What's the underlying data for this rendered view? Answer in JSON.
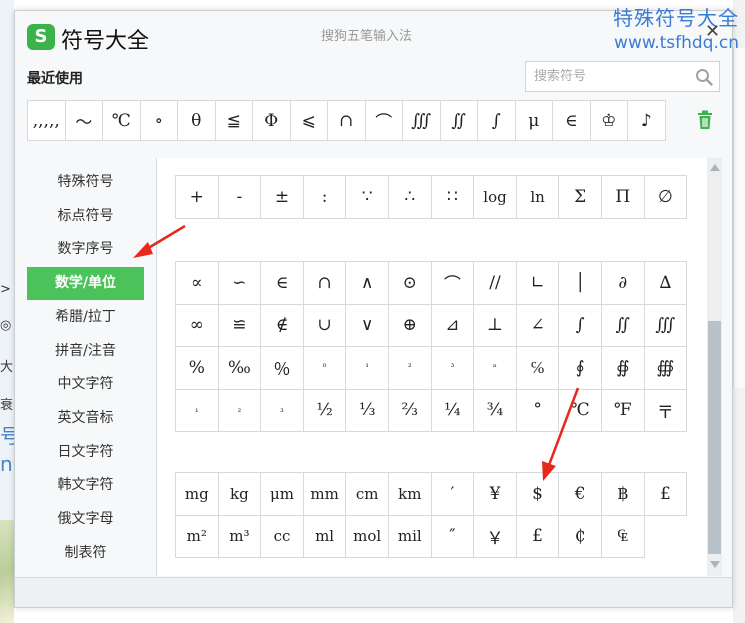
{
  "watermark": {
    "line1": "特殊符号大全",
    "line2": "www.tsfhdq.cn"
  },
  "window": {
    "logo_letter": "S",
    "app_title": "符号大全",
    "ime_name": "搜狗五笔输入法",
    "close_glyph": "✕"
  },
  "recent": {
    "label": "最近使用",
    "symbols": [
      ",,,,,",
      "～",
      "℃",
      "∘",
      "θ",
      "≦",
      "Φ",
      "⩽",
      "∩",
      "⌒",
      "∭",
      "∬",
      "∫",
      "μ",
      "∈",
      "♔",
      "♪"
    ]
  },
  "search": {
    "placeholder": "搜索符号"
  },
  "nav": {
    "items": [
      "特殊符号",
      "标点符号",
      "数字序号",
      "数学/单位",
      "希腊/拉丁",
      "拼音/注音",
      "中文字符",
      "英文音标",
      "日文字符",
      "韩文字符",
      "俄文字母",
      "制表符"
    ],
    "active_index": 3
  },
  "grid_top": [
    [
      "+",
      "-",
      "±",
      ":",
      "∵",
      "∴",
      "∷",
      "log",
      "ln",
      "Σ",
      "Π",
      "∅"
    ]
  ],
  "grid_math": [
    [
      "∝",
      "∽",
      "∈",
      "∩",
      "∧",
      "⊙",
      "⌒",
      "//",
      "∟",
      "│",
      "∂",
      "∆"
    ],
    [
      "∞",
      "≌",
      "∉",
      "∪",
      "∨",
      "⊕",
      "⊿",
      "⊥",
      "∠",
      "∫",
      "∬",
      "∭"
    ],
    [
      "%",
      "‰",
      "％",
      "⁰",
      "¹",
      "²",
      "³",
      "ⁿ",
      "℅",
      "∮",
      "∯",
      "∰"
    ],
    [
      "₁",
      "₂",
      "₃",
      "½",
      "⅓",
      "⅔",
      "¼",
      "¾",
      "°",
      "℃",
      "℉",
      "〒"
    ]
  ],
  "grid_units": [
    [
      "mg",
      "kg",
      "μm",
      "mm",
      "cm",
      "km",
      "′",
      "¥",
      "$",
      "€",
      "฿",
      "£"
    ],
    [
      "m²",
      "m³",
      "cc",
      "ml",
      "mol",
      "mil",
      "″",
      "￥",
      "£",
      "₵",
      "₠"
    ]
  ],
  "colors": {
    "accent": "#4cc35a",
    "annotation": "#e8281d",
    "watermark": "#3a7bd5"
  }
}
